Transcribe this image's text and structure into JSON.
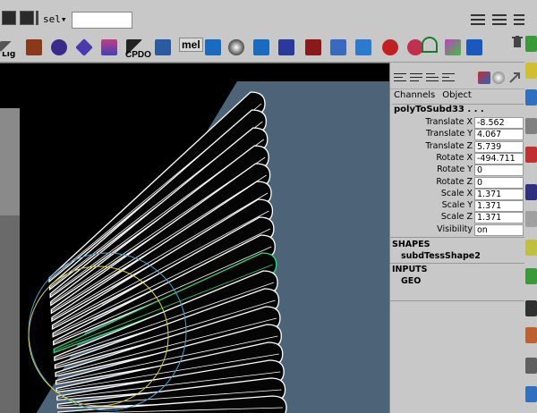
{
  "statusline": {
    "select_label": "sel▾",
    "select_input_value": ""
  },
  "shelf": {
    "tab_label": "Lig",
    "text_buttons": [
      {
        "label": "CPDO"
      },
      {
        "label": "mel"
      }
    ],
    "icons": [
      "render-icon",
      "bones-icon",
      "ik-handle-icon",
      "joint-icon",
      "texture-icon",
      "wedge-icon",
      "lattice-icon",
      "subdiv-icon",
      "sphere-icon",
      "sculpt-icon",
      "deform-icon",
      "paint-icon",
      "hair-icon",
      "jiggle-icon",
      "cluster-icon",
      "web-icon",
      "curve-icon",
      "graph-icon",
      "play-icon"
    ]
  },
  "channelbox": {
    "menus": [
      "Channels",
      "Object"
    ],
    "object_name": "polyToSubd33 . . .",
    "attributes": [
      {
        "label": "Translate X",
        "value": "-8.562"
      },
      {
        "label": "Translate Y",
        "value": "4.067"
      },
      {
        "label": "Translate Z",
        "value": "5.739"
      },
      {
        "label": "Rotate X",
        "value": "-494.711"
      },
      {
        "label": "Rotate Y",
        "value": "0"
      },
      {
        "label": "Rotate Z",
        "value": "0"
      },
      {
        "label": "Scale X",
        "value": "1.371"
      },
      {
        "label": "Scale Y",
        "value": "1.371"
      },
      {
        "label": "Scale Z",
        "value": "1.371"
      },
      {
        "label": "Visibility",
        "value": "on"
      }
    ],
    "shapes_header": "SHAPES",
    "shape_item": "subdTessShape2",
    "inputs_header": "INPUTS",
    "input_item": "GEO"
  },
  "colors": {
    "viewport_bg": "#000000",
    "backdrop_plane": "#4d6478",
    "wire": "#ffffff",
    "selected_wire": "#3ad67a",
    "ui_gray": "#c8c8c8"
  }
}
